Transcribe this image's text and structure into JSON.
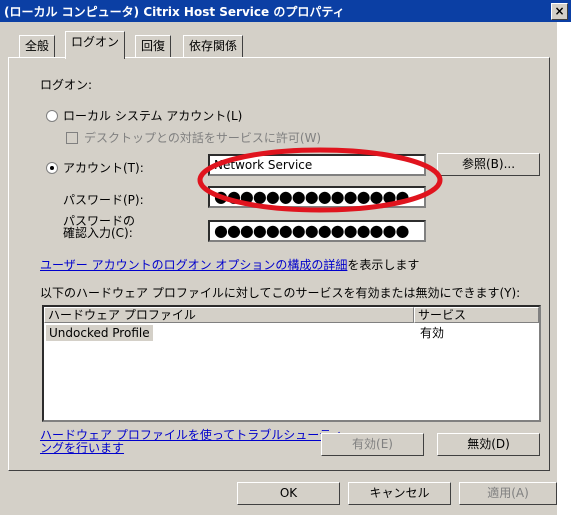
{
  "window": {
    "title": "(ローカル コンピュータ) Citrix Host Service のプロパティ",
    "close_label": "×"
  },
  "tabs": [
    {
      "label": "全般",
      "selected": false
    },
    {
      "label": "ログオン",
      "selected": true
    },
    {
      "label": "回復",
      "selected": false
    },
    {
      "label": "依存関係",
      "selected": false
    }
  ],
  "logon": {
    "section_label": "ログオン:",
    "local_system_label": "ローカル システム アカウント(L)",
    "desktop_interact_label": "デスクトップとの対話をサービスに許可(W)",
    "account_label": "アカウント(T):",
    "account_value": "Network Service",
    "browse_label": "参照(B)...",
    "password_label": "パスワード(P):",
    "password_mask": "●●●●●●●●●●●●●●●",
    "confirm_line1": "パスワードの",
    "confirm_line2": "確認入力(C):",
    "confirm_mask": "●●●●●●●●●●●●●●●",
    "options_link": "ユーザー アカウントのログオン オプションの構成の詳細",
    "options_suffix": "を表示します"
  },
  "profiles": {
    "intro": "以下のハードウェア プロファイルに対してこのサービスを有効または無効にできます(Y):",
    "col_profile": "ハードウェア プロファイル",
    "col_service": "サービス",
    "rows": [
      {
        "profile": "Undocked Profile",
        "service": "有効"
      }
    ],
    "troubleshoot_line1": "ハードウェア プロファイルを使ってトラブルシューティ",
    "troubleshoot_line2": "ングを行います",
    "enable_label": "有効(E)",
    "disable_label": "無効(D)"
  },
  "footer": {
    "ok": "OK",
    "cancel": "キャンセル",
    "apply": "適用(A)"
  },
  "colors": {
    "title_bar": "#0b3fa4",
    "face": "#d4d0c8",
    "link": "#0000cc",
    "highlight_circle": "#e0141e"
  }
}
